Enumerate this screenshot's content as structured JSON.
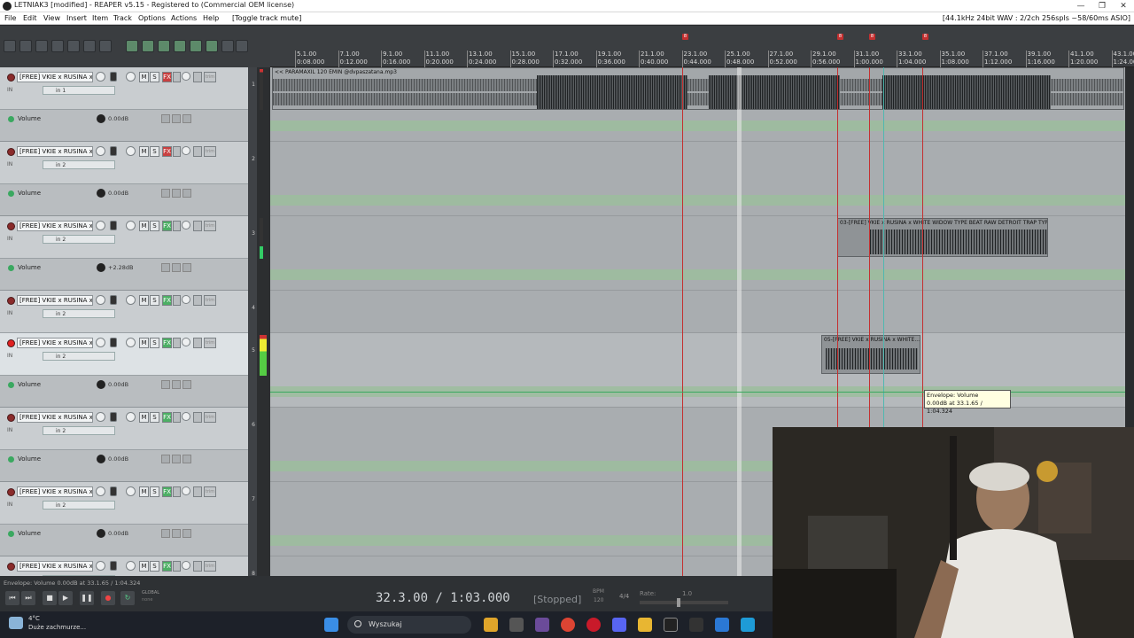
{
  "window": {
    "title": "LETNIAK3 [modified] - REAPER v5.15 - Registered to  (Commercial OEM license)",
    "controls": [
      "—",
      "❐",
      "✕"
    ]
  },
  "menu": {
    "items": [
      "File",
      "Edit",
      "View",
      "Insert",
      "Item",
      "Track",
      "Options",
      "Actions",
      "Help",
      "[Toggle track mute]"
    ],
    "audio_info": "[44.1kHz 24bit WAV : 2/2ch 256spls ~58/60ms ASIO]"
  },
  "ruler": {
    "bars": [
      "5.1.00",
      "7.1.00",
      "9.1.00",
      "11.1.00",
      "13.1.00",
      "15.1.00",
      "17.1.00",
      "19.1.00",
      "21.1.00",
      "23.1.00",
      "25.1.00",
      "27.1.00",
      "29.1.00",
      "31.1.00",
      "33.1.00",
      "35.1.00",
      "37.1.00",
      "39.1.00",
      "41.1.00",
      "43.1.00"
    ],
    "times": [
      "0:08.000",
      "0:12.000",
      "0:16.000",
      "0:20.000",
      "0:24.000",
      "0:28.000",
      "0:32.000",
      "0:36.000",
      "0:40.000",
      "0:44.000",
      "0:48.000",
      "0:52.000",
      "0:56.000",
      "1:00.000",
      "1:04.000",
      "1:08.000",
      "1:12.000",
      "1:16.000",
      "1:20.000",
      "1:24.000"
    ],
    "markers": [
      "8",
      "8",
      "8",
      "8"
    ]
  },
  "tracks": [
    {
      "number": "1",
      "name": "[FREE] VKIE x RUSINA x V",
      "input": "in 1",
      "fx_active": false,
      "armed": false,
      "selected": false,
      "env_label": "Volume",
      "env_value": "0.00dB"
    },
    {
      "number": "2",
      "name": "[FREE] VKIE x RUSINA x V",
      "input": "in 2",
      "fx_active": false,
      "armed": false,
      "selected": false,
      "env_label": "Volume",
      "env_value": "0.00dB"
    },
    {
      "number": "3",
      "name": "[FREE] VKIE x RUSINA x V",
      "input": "in 2",
      "fx_active": true,
      "armed": false,
      "selected": false,
      "env_label": "Volume",
      "env_value": "+2.28dB"
    },
    {
      "number": "4",
      "name": "[FREE] VKIE x RUSINA x V",
      "input": "in 2",
      "fx_active": true,
      "armed": false,
      "selected": false
    },
    {
      "number": "5",
      "name": "[FREE] VKIE x RUSINA x V",
      "input": "in 2",
      "fx_active": true,
      "armed": true,
      "selected": true,
      "env_label": "Volume",
      "env_value": "0.00dB"
    },
    {
      "number": "6",
      "name": "[FREE] VKIE x RUSINA x V",
      "input": "in 2",
      "fx_active": true,
      "armed": false,
      "selected": false,
      "env_label": "Volume",
      "env_value": "0.00dB"
    },
    {
      "number": "7",
      "name": "[FREE] VKIE x RUSINA x V",
      "input": "in 2",
      "fx_active": true,
      "armed": false,
      "selected": false,
      "env_label": "Volume",
      "env_value": "0.00dB"
    },
    {
      "number": "8",
      "name": "[FREE] VKIE x RUSINA x V",
      "input": "in 2",
      "fx_active": true,
      "armed": false,
      "selected": false
    }
  ],
  "track_buttons": {
    "mute": "M",
    "solo": "S",
    "fx": "FX",
    "trim": "trim",
    "in": "IN"
  },
  "items": {
    "main": "<< PARAMAXIL 120 EMIN @dvpaszatana.mp3",
    "track3": "03-[FREE] VKIE x RUSINA x WHITE WIDOW TYPE BEAT  RAW  DETROIT TRAP TYP...",
    "track5": "05-[FREE] VKIE x RUSINA x WHITE..."
  },
  "tooltip": {
    "line1": "Envelope: Volume",
    "line2": "0.00dB at 33.1.65 / 1:04.324"
  },
  "status_hint": "Envelope: Volume 0.00dB at 33.1.65 / 1:04.324",
  "transport": {
    "position": "32.3.00 / 1:03.000",
    "state": "[Stopped]",
    "bpm_label": "BPM",
    "bpm": "120",
    "signature": "4/4",
    "rate_label": "Rate:",
    "rate": "1.0",
    "global": "GLOBAL",
    "global_sub": "none"
  },
  "taskbar": {
    "weather_temp": "4°C",
    "weather_desc": "Duże zachmurze...",
    "search": "Wyszukaj"
  },
  "colors": {
    "record": "#e02020",
    "marker": "#c43030",
    "fx_on": "#4caf64",
    "fx_off": "#c84040",
    "envelope": "#3aa860"
  }
}
